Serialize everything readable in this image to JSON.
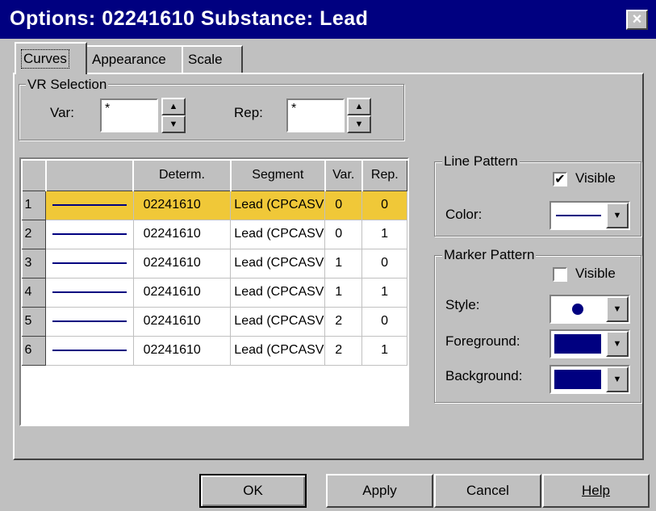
{
  "window": {
    "title": "Options: 02241610 Substance: Lead",
    "close_label": "×"
  },
  "tabs": [
    {
      "label": "Curves"
    },
    {
      "label": "Appearance"
    },
    {
      "label": "Scale"
    }
  ],
  "vr_selection": {
    "label": "VR Selection",
    "var_label": "Var:",
    "var_value": "*",
    "rep_label": "Rep:",
    "rep_value": "*"
  },
  "grid": {
    "headers": [
      "",
      "",
      "Determ.",
      "Segment",
      "Var.",
      "Rep."
    ],
    "rows": [
      {
        "num": "1",
        "determ": "02241610",
        "segment": "Lead (CPCASV",
        "var": "0",
        "rep": "0"
      },
      {
        "num": "2",
        "determ": "02241610",
        "segment": "Lead (CPCASV",
        "var": "0",
        "rep": "1"
      },
      {
        "num": "3",
        "determ": "02241610",
        "segment": "Lead (CPCASV",
        "var": "1",
        "rep": "0"
      },
      {
        "num": "4",
        "determ": "02241610",
        "segment": "Lead (CPCASV",
        "var": "1",
        "rep": "1"
      },
      {
        "num": "5",
        "determ": "02241610",
        "segment": "Lead (CPCASV",
        "var": "2",
        "rep": "0"
      },
      {
        "num": "6",
        "determ": "02241610",
        "segment": "Lead (CPCASV",
        "var": "2",
        "rep": "1"
      }
    ],
    "selected_row": 1
  },
  "line_pattern": {
    "label": "Line Pattern",
    "visible_label": "Visible",
    "visible_checked": "✔",
    "color_label": "Color:"
  },
  "marker_pattern": {
    "label": "Marker Pattern",
    "visible_label": "Visible",
    "visible_checked": "",
    "style_label": "Style:",
    "foreground_label": "Foreground:",
    "background_label": "Background:"
  },
  "buttons": {
    "ok": "OK",
    "apply": "Apply",
    "cancel": "Cancel",
    "help": "Help"
  },
  "colors": {
    "title_bar": "#000080",
    "selection": "#f0c838",
    "line": "#000080"
  },
  "icons": {
    "spin_up": "triangle-up",
    "spin_down": "triangle-down",
    "dropdown": "triangle-down",
    "marker": "filled-circle"
  }
}
